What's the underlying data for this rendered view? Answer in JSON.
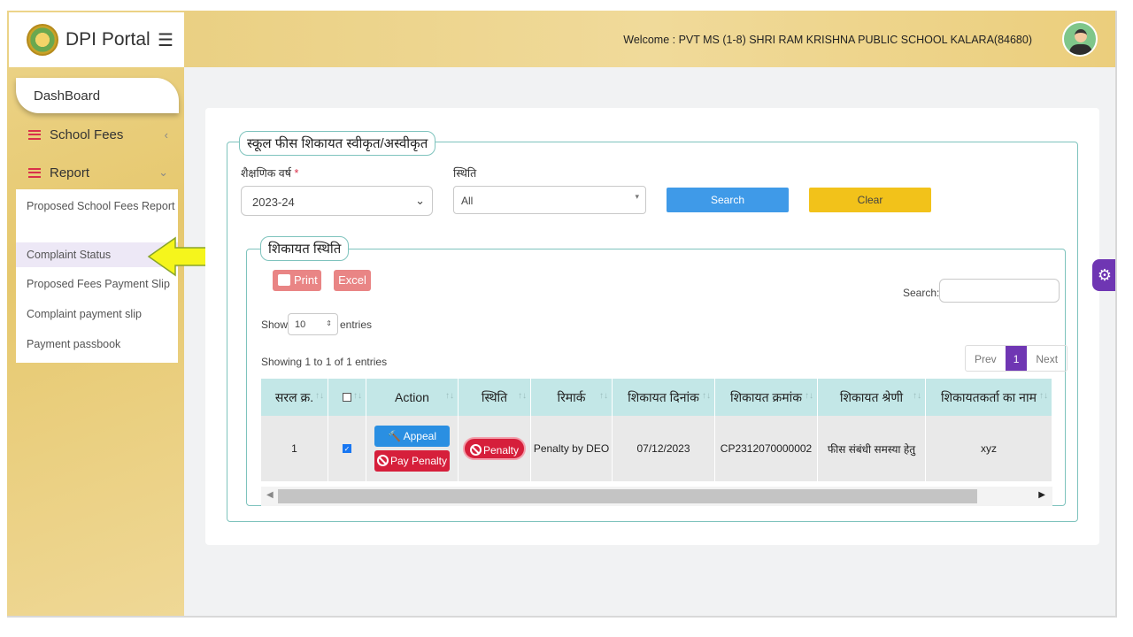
{
  "brand": {
    "title": "DPI Portal"
  },
  "header": {
    "welcome": "Welcome : PVT MS (1-8) SHRI RAM KRISHNA PUBLIC SCHOOL KALARA(84680)"
  },
  "sidebar": {
    "dashboard": "DashBoard",
    "items": [
      {
        "label": "School Fees",
        "chevron": "‹"
      },
      {
        "label": "Report",
        "chevron": "⌄"
      }
    ],
    "submenu": [
      "Proposed School Fees Report",
      "Complaint Status",
      "Proposed Fees Payment Slip",
      "Complaint payment slip",
      "Payment passbook"
    ],
    "active_submenu": "Complaint Status"
  },
  "form": {
    "legend": "स्कूल फीस शिकायत स्वीकृत/अस्वीकृत",
    "year_label": "शैक्षणिक वर्ष",
    "year_required": "*",
    "year_value": "2023-24",
    "status_label": "स्थिति",
    "status_value": "All",
    "search_button": "Search",
    "clear_button": "Clear"
  },
  "results": {
    "legend": "शिकायत स्थिति",
    "print_button": "Print",
    "excel_button": "Excel",
    "search_label": "Search:",
    "show_label": "Show",
    "page_length": "10",
    "entries_label": "entries",
    "info": "Showing 1 to 1 of 1 entries",
    "pager": {
      "prev": "Prev",
      "current": "1",
      "next": "Next"
    },
    "columns": [
      "सरल क्र.",
      "",
      "Action",
      "स्थिति",
      "रिमार्क",
      "शिकायत दिनांक",
      "शिकायत क्रमांक",
      "शिकायत श्रेणी",
      "शिकायतकर्ता का नाम"
    ],
    "rows": [
      {
        "serial": "1",
        "checked": true,
        "appeal_button": "Appeal",
        "pay_button": "Pay Penalty",
        "status": "Penalty",
        "remark": "Penalty by DEO",
        "date": "07/12/2023",
        "complaint_no": "CP2312070000002",
        "category": "फीस संबंधी समस्या हेतु",
        "complainant": "xyz"
      }
    ]
  },
  "colors": {
    "accent_purple": "#6f36b3",
    "search_blue": "#3f9ae8",
    "clear_yellow": "#f2c21a",
    "danger_red": "#d61f3b",
    "table_header": "#c3e7e7",
    "arrow_yellow": "#f5f51c"
  },
  "icons": [
    "logo-icon",
    "hamburger-icon",
    "menu-bars-icon",
    "chevron-icon",
    "avatar-icon",
    "printer-icon",
    "gavel-icon",
    "ban-icon",
    "gear-icon",
    "sort-icon",
    "arrow-left-icon"
  ]
}
